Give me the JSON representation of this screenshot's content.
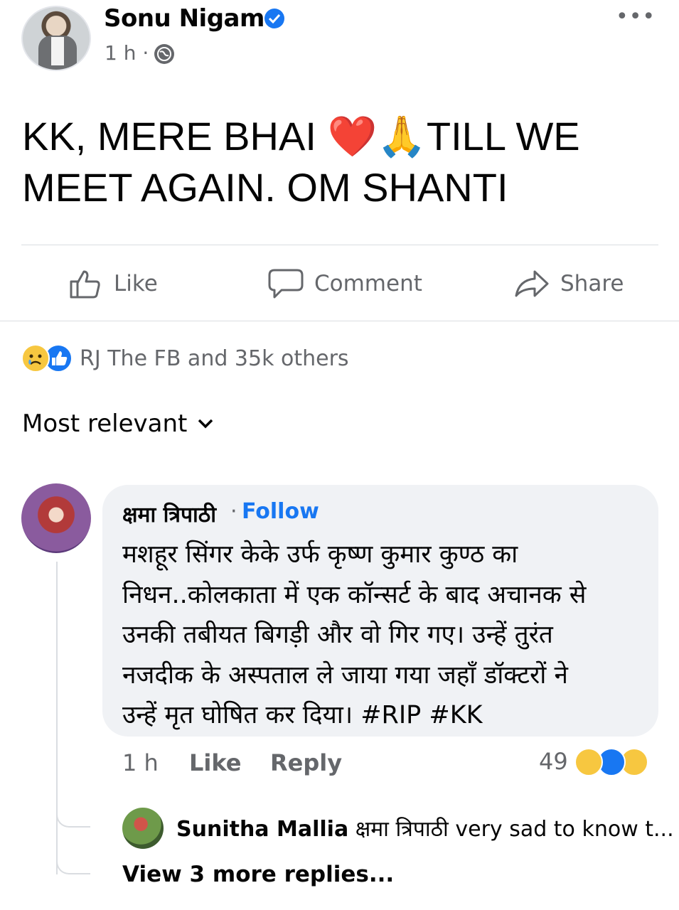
{
  "post": {
    "author": "Sonu Nigam",
    "time": "1 h ·",
    "text_line1_a": "KK, MERE BHAI ",
    "text_line1_emoji_heart": "❤️",
    "text_line1_emoji_pray": "🙏",
    "text_line1_b": "TILL WE",
    "text_line2": "MEET AGAIN. OM SHANTI"
  },
  "actions": {
    "like": "Like",
    "comment": "Comment",
    "share": "Share"
  },
  "reactions": {
    "summary": "RJ The FB and 35k others",
    "icons": [
      "sad-reaction-icon",
      "like-reaction-icon"
    ]
  },
  "sort": {
    "label": "Most relevant"
  },
  "comment": {
    "author": "क्षमा त्रिपाठी",
    "dot": "·",
    "follow": "Follow",
    "lines": [
      "मशहूर सिंगर केके उर्फ कृष्ण कुमार कुण्ठ का",
      "निधन..कोलकाता में एक कॉन्सर्ट के बाद अचानक से",
      "उनकी तबीयत बिगड़ी और वो गिर गए। उन्हें तुरंत",
      "नजदीक के अस्पताल ले जाया गया जहाँ  डॉक्टरों ने",
      "उन्हें मृत घोषित कर दिया। #RIP #KK"
    ],
    "time": "1 h",
    "like": "Like",
    "reply": "Reply",
    "reaction_count": "49"
  },
  "reply": {
    "author": "Sunitha Mallia",
    "text": "क्षमा त्रिपाठी  very sad to know t...",
    "view_more": "View 3 more replies..."
  },
  "colors": {
    "accent": "#1877f2",
    "secondary_text": "#65676b",
    "bubble": "#f0f2f5"
  }
}
